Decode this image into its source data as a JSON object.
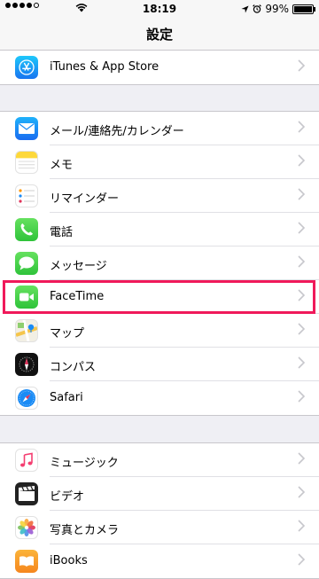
{
  "status_bar": {
    "time": "18:19",
    "battery": "99%",
    "battery_level": 0.99
  },
  "nav": {
    "title": "設定"
  },
  "groups": [
    {
      "rows": [
        {
          "label": "iTunes & App Store",
          "icon": "app-store-icon"
        }
      ]
    },
    {
      "rows": [
        {
          "label": "メール/連絡先/カレンダー",
          "icon": "mail-icon"
        },
        {
          "label": "メモ",
          "icon": "notes-icon"
        },
        {
          "label": "リマインダー",
          "icon": "reminders-icon"
        },
        {
          "label": "電話",
          "icon": "phone-icon"
        },
        {
          "label": "メッセージ",
          "icon": "messages-icon"
        },
        {
          "label": "FaceTime",
          "icon": "facetime-icon"
        },
        {
          "label": "マップ",
          "icon": "maps-icon"
        },
        {
          "label": "コンパス",
          "icon": "compass-icon"
        },
        {
          "label": "Safari",
          "icon": "safari-icon"
        }
      ]
    },
    {
      "rows": [
        {
          "label": "ミュージック",
          "icon": "music-icon"
        },
        {
          "label": "ビデオ",
          "icon": "videos-icon"
        },
        {
          "label": "写真とカメラ",
          "icon": "photos-icon"
        },
        {
          "label": "iBooks",
          "icon": "ibooks-icon"
        }
      ]
    }
  ],
  "colors": {
    "highlight": "#f0195a",
    "background": "#efeff4"
  }
}
